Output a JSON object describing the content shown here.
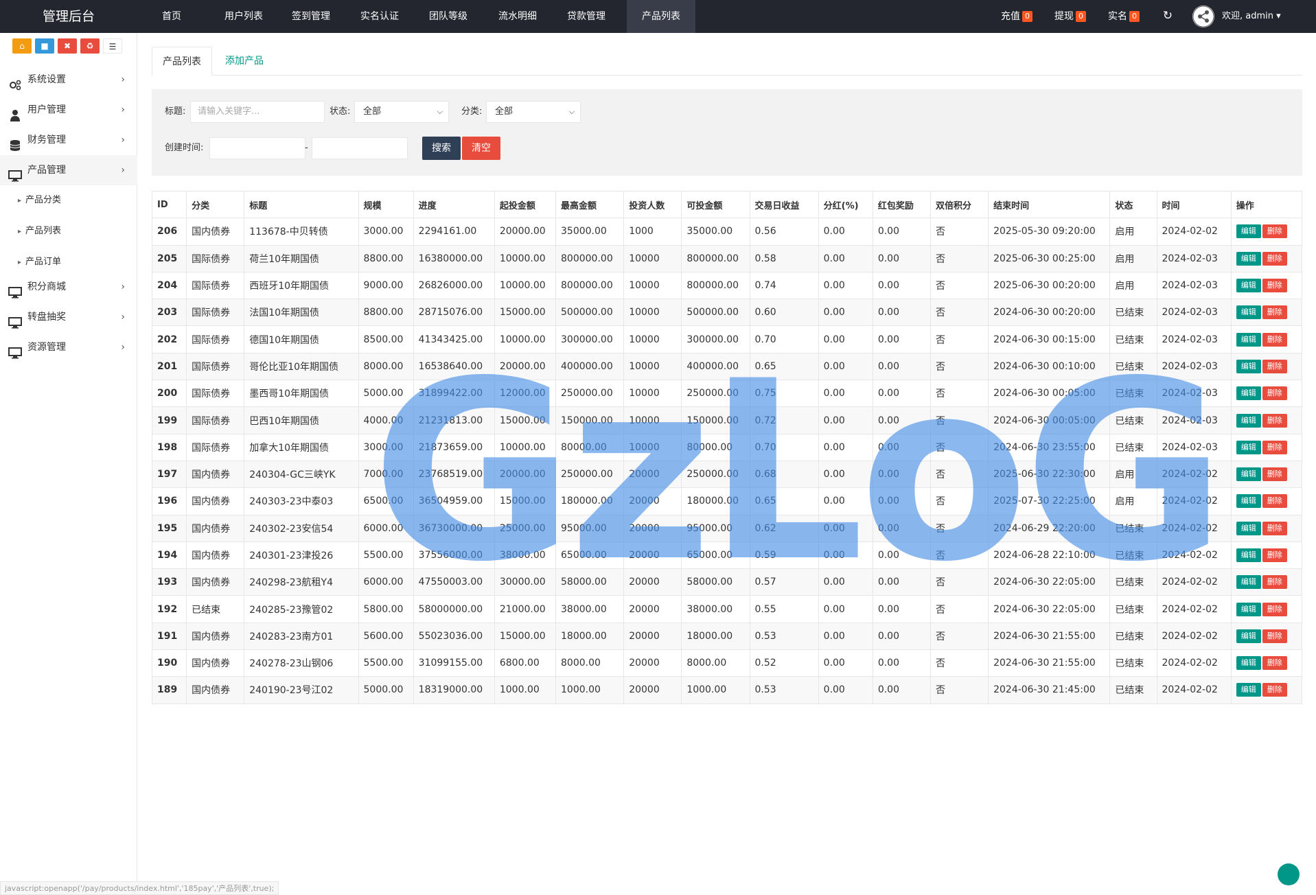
{
  "app": {
    "title": "管理后台"
  },
  "topnav": {
    "items": [
      {
        "label": "首页"
      },
      {
        "label": "用户列表"
      },
      {
        "label": "签到管理"
      },
      {
        "label": "实名认证"
      },
      {
        "label": "团队等级"
      },
      {
        "label": "流水明细"
      },
      {
        "label": "贷款管理"
      },
      {
        "label": "产品列表"
      }
    ],
    "active_index": 7,
    "recharge_label": "充值",
    "recharge_count": "0",
    "withdraw_label": "提现",
    "withdraw_count": "0",
    "realname_label": "实名",
    "realname_count": "0",
    "welcome": "欢迎, admin"
  },
  "sidebar": {
    "quick_buttons": [
      {
        "icon": "home-icon",
        "color": "#f39c12"
      },
      {
        "icon": "file-icon",
        "color": "#3498db"
      },
      {
        "icon": "trash-icon",
        "color": "#e74c3c"
      },
      {
        "icon": "recycle-icon",
        "color": "#e74c3c"
      },
      {
        "icon": "list-icon",
        "color": "#ffffff"
      }
    ],
    "items": [
      {
        "label": "系统设置",
        "icon": "gears-icon"
      },
      {
        "label": "用户管理",
        "icon": "user-icon"
      },
      {
        "label": "财务管理",
        "icon": "database-icon"
      },
      {
        "label": "产品管理",
        "icon": "monitor-icon"
      },
      {
        "label": "积分商城",
        "icon": "monitor-icon"
      },
      {
        "label": "转盘抽奖",
        "icon": "monitor-icon"
      },
      {
        "label": "资源管理",
        "icon": "monitor-icon"
      }
    ],
    "sub_items": [
      {
        "label": "产品分类"
      },
      {
        "label": "产品列表"
      },
      {
        "label": "产品订单"
      }
    ]
  },
  "tabs": [
    {
      "label": "产品列表"
    },
    {
      "label": "添加产品"
    }
  ],
  "filter": {
    "title_label": "标题:",
    "title_placeholder": "请输入关键字...",
    "status_label": "状态:",
    "status_value": "全部",
    "category_label": "分类:",
    "category_value": "全部",
    "created_label": "创建时间:",
    "range_sep": "-",
    "search_label": "搜索",
    "clear_label": "清空"
  },
  "table": {
    "headers": [
      "ID",
      "分类",
      "标题",
      "规模",
      "进度",
      "起投金额",
      "最高金额",
      "投资人数",
      "可投金额",
      "交易日收益",
      "分红(%)",
      "红包奖励",
      "双倍积分",
      "结束时间",
      "状态",
      "时间",
      "操作"
    ],
    "edit_label": "编辑",
    "delete_label": "删除",
    "rows": [
      [
        "206",
        "国内债券",
        "113678-中贝转债",
        "3000.00",
        "2294161.00",
        "20000.00",
        "35000.00",
        "1000",
        "35000.00",
        "0.56",
        "0.00",
        "0.00",
        "否",
        "2025-05-30 09:20:00",
        "启用",
        "2024-02-02"
      ],
      [
        "205",
        "国际债券",
        "荷兰10年期国债",
        "8800.00",
        "16380000.00",
        "10000.00",
        "800000.00",
        "10000",
        "800000.00",
        "0.58",
        "0.00",
        "0.00",
        "否",
        "2025-06-30 00:25:00",
        "启用",
        "2024-02-03"
      ],
      [
        "204",
        "国际债券",
        "西班牙10年期国债",
        "9000.00",
        "26826000.00",
        "10000.00",
        "800000.00",
        "10000",
        "800000.00",
        "0.74",
        "0.00",
        "0.00",
        "否",
        "2025-06-30 00:20:00",
        "启用",
        "2024-02-03"
      ],
      [
        "203",
        "国际债券",
        "法国10年期国债",
        "8800.00",
        "28715076.00",
        "15000.00",
        "500000.00",
        "10000",
        "500000.00",
        "0.60",
        "0.00",
        "0.00",
        "否",
        "2024-06-30 00:20:00",
        "已结束",
        "2024-02-03"
      ],
      [
        "202",
        "国际债券",
        "德国10年期国债",
        "8500.00",
        "41343425.00",
        "10000.00",
        "300000.00",
        "10000",
        "300000.00",
        "0.70",
        "0.00",
        "0.00",
        "否",
        "2024-06-30 00:15:00",
        "已结束",
        "2024-02-03"
      ],
      [
        "201",
        "国际债券",
        "哥伦比亚10年期国债",
        "8000.00",
        "16538640.00",
        "20000.00",
        "400000.00",
        "10000",
        "400000.00",
        "0.65",
        "0.00",
        "0.00",
        "否",
        "2024-06-30 00:10:00",
        "已结束",
        "2024-02-03"
      ],
      [
        "200",
        "国际债券",
        "墨西哥10年期国债",
        "5000.00",
        "31899422.00",
        "12000.00",
        "250000.00",
        "10000",
        "250000.00",
        "0.75",
        "0.00",
        "0.00",
        "否",
        "2024-06-30 00:05:00",
        "已结束",
        "2024-02-03"
      ],
      [
        "199",
        "国际债券",
        "巴西10年期国债",
        "4000.00",
        "21231813.00",
        "15000.00",
        "150000.00",
        "10000",
        "150000.00",
        "0.72",
        "0.00",
        "0.00",
        "否",
        "2024-06-30 00:05:00",
        "已结束",
        "2024-02-03"
      ],
      [
        "198",
        "国际债券",
        "加拿大10年期国债",
        "3000.00",
        "21873659.00",
        "10000.00",
        "80000.00",
        "10000",
        "80000.00",
        "0.70",
        "0.00",
        "0.00",
        "否",
        "2024-06-30 23:55:00",
        "已结束",
        "2024-02-03"
      ],
      [
        "197",
        "国内债券",
        "240304-GC三峡YK",
        "7000.00",
        "23768519.00",
        "20000.00",
        "250000.00",
        "20000",
        "250000.00",
        "0.68",
        "0.00",
        "0.00",
        "否",
        "2025-06-30 22:30:00",
        "启用",
        "2024-02-02"
      ],
      [
        "196",
        "国内债券",
        "240303-23中泰03",
        "6500.00",
        "36504959.00",
        "15000.00",
        "180000.00",
        "20000",
        "180000.00",
        "0.65",
        "0.00",
        "0.00",
        "否",
        "2025-07-30 22:25:00",
        "启用",
        "2024-02-02"
      ],
      [
        "195",
        "国内债券",
        "240302-23安信54",
        "6000.00",
        "36730000.00",
        "25000.00",
        "95000.00",
        "20000",
        "95000.00",
        "0.62",
        "0.00",
        "0.00",
        "否",
        "2024-06-29 22:20:00",
        "已结束",
        "2024-02-02"
      ],
      [
        "194",
        "国内债券",
        "240301-23津投26",
        "5500.00",
        "37556000.00",
        "38000.00",
        "65000.00",
        "20000",
        "65000.00",
        "0.59",
        "0.00",
        "0.00",
        "否",
        "2024-06-28 22:10:00",
        "已结束",
        "2024-02-02"
      ],
      [
        "193",
        "国内债券",
        "240298-23航租Y4",
        "6000.00",
        "47550003.00",
        "30000.00",
        "58000.00",
        "20000",
        "58000.00",
        "0.57",
        "0.00",
        "0.00",
        "否",
        "2024-06-30 22:05:00",
        "已结束",
        "2024-02-02"
      ],
      [
        "192",
        "已结束",
        "240285-23豫管02",
        "5800.00",
        "58000000.00",
        "21000.00",
        "38000.00",
        "20000",
        "38000.00",
        "0.55",
        "0.00",
        "0.00",
        "否",
        "2024-06-30 22:05:00",
        "已结束",
        "2024-02-02"
      ],
      [
        "191",
        "国内债券",
        "240283-23南方01",
        "5600.00",
        "55023036.00",
        "15000.00",
        "18000.00",
        "20000",
        "18000.00",
        "0.53",
        "0.00",
        "0.00",
        "否",
        "2024-06-30 21:55:00",
        "已结束",
        "2024-02-02"
      ],
      [
        "190",
        "国内债券",
        "240278-23山钢06",
        "5500.00",
        "31099155.00",
        "6800.00",
        "8000.00",
        "20000",
        "8000.00",
        "0.52",
        "0.00",
        "0.00",
        "否",
        "2024-06-30 21:55:00",
        "已结束",
        "2024-02-02"
      ],
      [
        "189",
        "国内债券",
        "240190-23号江02",
        "5000.00",
        "18319000.00",
        "1000.00",
        "1000.00",
        "20000",
        "1000.00",
        "0.53",
        "0.00",
        "0.00",
        "否",
        "2024-06-30 21:45:00",
        "已结束",
        "2024-02-02"
      ]
    ]
  },
  "watermark": {
    "text": "GzLoG"
  },
  "statusbar": {
    "text": "javascript:openapp('/pay/products/index.html','185pay','产品列表',true);"
  }
}
